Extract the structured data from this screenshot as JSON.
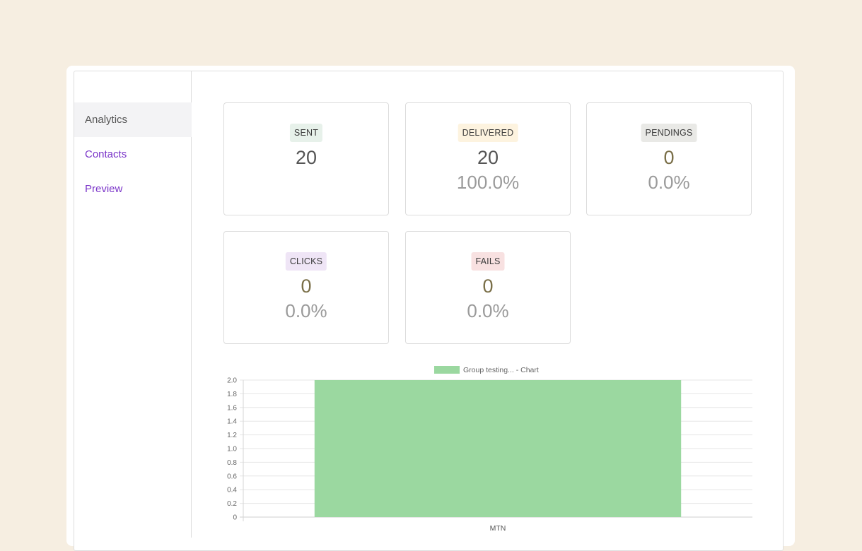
{
  "sidebar": {
    "items": [
      {
        "label": "Analytics",
        "active": true
      },
      {
        "label": "Contacts",
        "active": false
      },
      {
        "label": "Preview",
        "active": false
      }
    ]
  },
  "stats": {
    "sent": {
      "label": "SENT",
      "count": "20",
      "badge_color": "#e7f1ea"
    },
    "delivered": {
      "label": "DELIVERED",
      "count": "20",
      "percent": "100.0%",
      "badge_color": "#fdf3df"
    },
    "pendings": {
      "label": "PENDINGS",
      "count": "0",
      "percent": "0.0%",
      "badge_color": "#e9e9e6"
    },
    "clicks": {
      "label": "CLICKS",
      "count": "0",
      "percent": "0.0%",
      "badge_color": "#efe5f6"
    },
    "fails": {
      "label": "FAILS",
      "count": "0",
      "percent": "0.0%",
      "badge_color": "#f8e1e1"
    }
  },
  "chart_data": {
    "type": "bar",
    "categories": [
      "MTN"
    ],
    "series": [
      {
        "name": "Group testing... - Chart",
        "values": [
          2.0
        ],
        "color": "#9bd8a0"
      }
    ],
    "ylim": [
      0,
      2.0
    ],
    "yticks": [
      "0",
      "0.2",
      "0.4",
      "0.6",
      "0.8",
      "1.0",
      "1.2",
      "1.4",
      "1.6",
      "1.8",
      "2.0"
    ],
    "legend": "top",
    "grid": true
  }
}
